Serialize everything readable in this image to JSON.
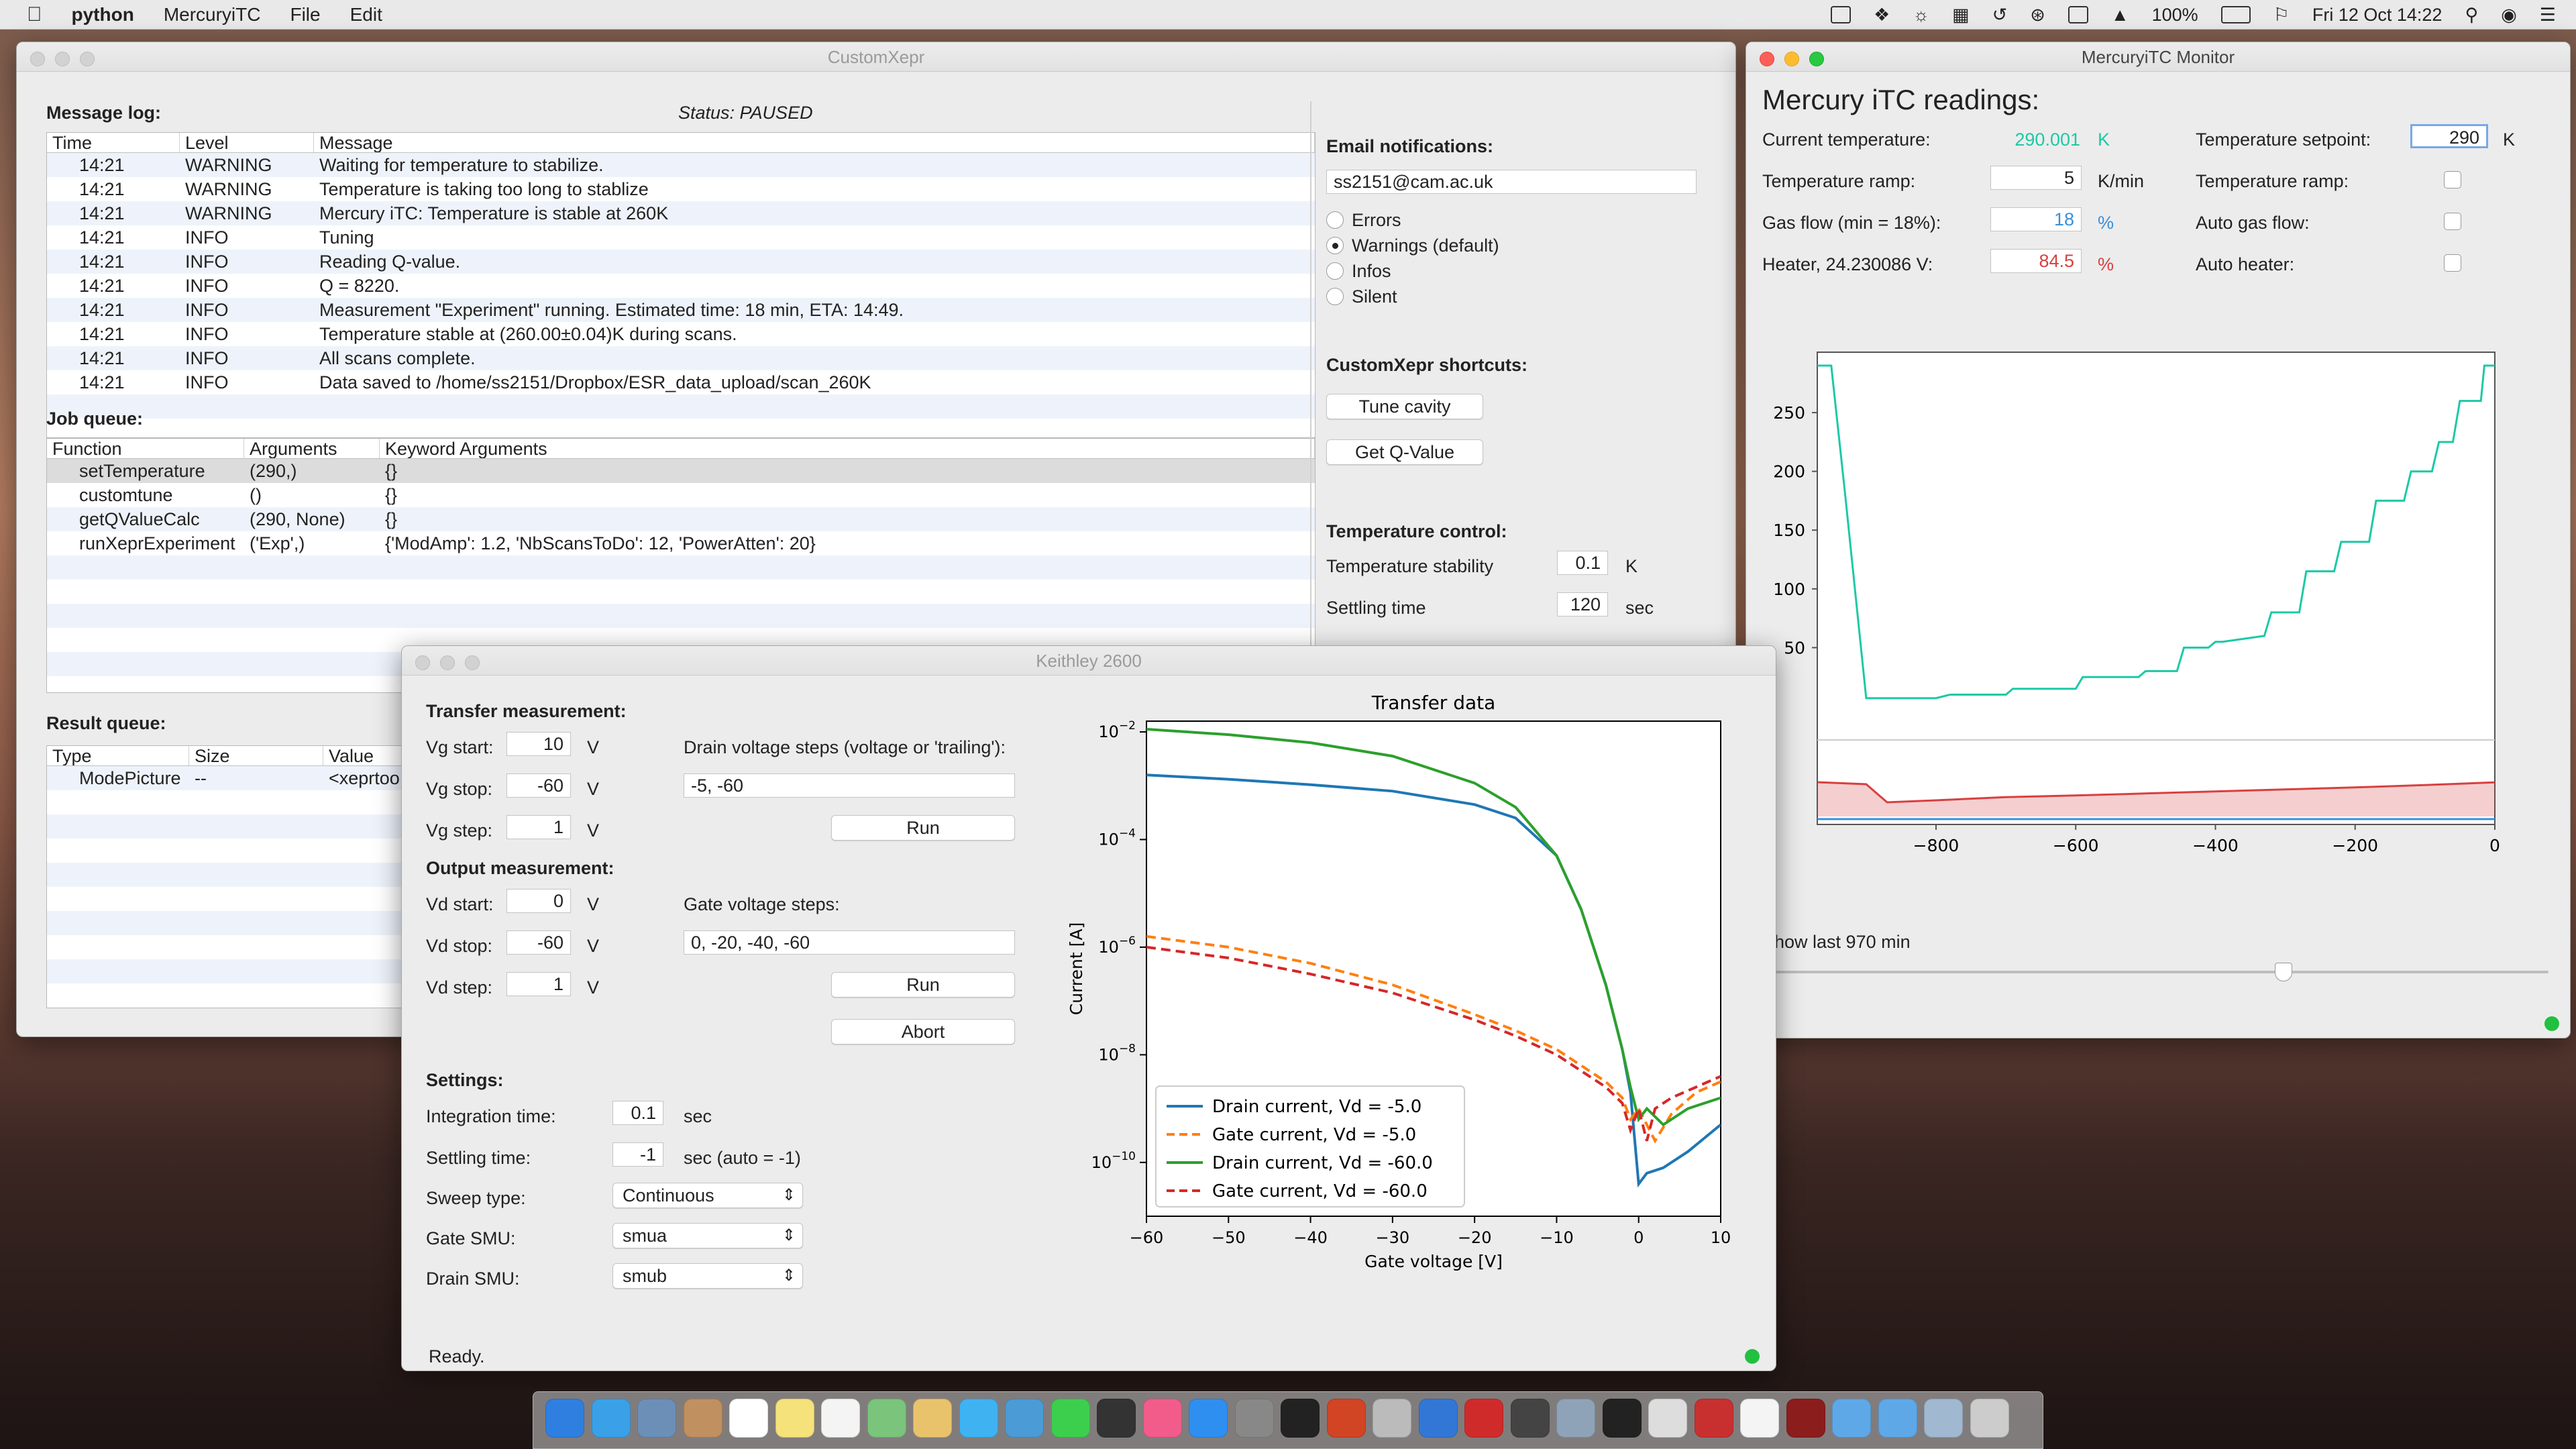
{
  "menubar": {
    "apple": "",
    "app": "python",
    "items": [
      "MercuryiTC",
      "File",
      "Edit"
    ],
    "battery": "100%",
    "datetime": "Fri 12 Oct  14:22"
  },
  "customxepr": {
    "title": "CustomXepr",
    "message_log_label": "Message log:",
    "status": "Status: PAUSED",
    "log_columns": [
      "Time",
      "Level",
      "Message"
    ],
    "log_rows": [
      [
        "14:21",
        "WARNING",
        "Waiting for temperature to stabilize."
      ],
      [
        "14:21",
        "WARNING",
        "Temperature is taking too long to stablize"
      ],
      [
        "14:21",
        "WARNING",
        "Mercury iTC: Temperature is stable at 260K"
      ],
      [
        "14:21",
        "INFO",
        "Tuning"
      ],
      [
        "14:21",
        "INFO",
        "Reading Q-value."
      ],
      [
        "14:21",
        "INFO",
        "Q = 8220."
      ],
      [
        "14:21",
        "INFO",
        "Measurement \"Experiment\" running. Estimated time: 18 min, ETA: 14:49."
      ],
      [
        "14:21",
        "INFO",
        "Temperature stable at (260.00±0.04)K during scans."
      ],
      [
        "14:21",
        "INFO",
        "All scans complete."
      ],
      [
        "14:21",
        "INFO",
        "Data saved to /home/ss2151/Dropbox/ESR_data_upload/scan_260K"
      ]
    ],
    "job_queue_label": "Job queue:",
    "job_columns": [
      "Function",
      "Arguments",
      "Keyword Arguments"
    ],
    "job_rows": [
      [
        "setTemperature",
        "(290,)",
        "{}"
      ],
      [
        "customtune",
        "()",
        "{}"
      ],
      [
        "getQValueCalc",
        "(290, None)",
        "{}"
      ],
      [
        "runXeprExperiment",
        "('Exp',)",
        "{'ModAmp': 1.2, 'NbScansToDo': 12, 'PowerAtten': 20}"
      ]
    ],
    "result_queue_label": "Result queue:",
    "result_columns": [
      "Type",
      "Size",
      "Value"
    ],
    "result_rows": [
      [
        "ModePicture",
        "--",
        "<xeprtoo"
      ]
    ],
    "email_label": "Email notifications:",
    "email_value": "ss2151@cam.ac.uk",
    "notify_options": [
      "Errors",
      "Warnings (default)",
      "Infos",
      "Silent"
    ],
    "notify_selected": "Warnings (default)",
    "shortcuts_label": "CustomXepr shortcuts:",
    "tune_button": "Tune cavity",
    "qvalue_button": "Get Q-Value",
    "temp_control_label": "Temperature control:",
    "stability_label": "Temperature stability",
    "stability_value": "0.1",
    "stability_unit": "K",
    "settling_label": "Settling time",
    "settling_value": "120",
    "settling_unit": "sec"
  },
  "keithley": {
    "title": "Keithley 2600",
    "transfer_label": "Transfer measurement:",
    "vg_start_label": "Vg start:",
    "vg_start": "10",
    "vg_stop_label": "Vg stop:",
    "vg_stop": "-60",
    "vg_step_label": "Vg step:",
    "vg_step": "1",
    "unit_v": "V",
    "drain_steps_label": "Drain voltage steps (voltage or 'trailing'):",
    "drain_steps": "-5, -60",
    "run_label": "Run",
    "output_label": "Output measurement:",
    "vd_start_label": "Vd start:",
    "vd_start": "0",
    "vd_stop_label": "Vd stop:",
    "vd_stop": "-60",
    "vd_step_label": "Vd step:",
    "vd_step": "1",
    "gate_steps_label": "Gate voltage steps:",
    "gate_steps": "0, -20, -40, -60",
    "abort_label": "Abort",
    "settings_label": "Settings:",
    "integration_label": "Integration time:",
    "integration": "0.1",
    "integration_unit": "sec",
    "settling_label": "Settling time:",
    "settling": "-1",
    "settling_unit": "sec (auto = -1)",
    "sweep_label": "Sweep type:",
    "sweep": "Continuous",
    "gate_smu_label": "Gate SMU:",
    "gate_smu": "smua",
    "drain_smu_label": "Drain SMU:",
    "drain_smu": "smub",
    "status": "Ready."
  },
  "mercury": {
    "title": "MercuryiTC Monitor",
    "heading": "Mercury iTC readings:",
    "current_temp_label": "Current temperature:",
    "current_temp": "290.001",
    "k": "K",
    "setpoint_label": "Temperature setpoint:",
    "setpoint": "290",
    "ramp_label": "Temperature ramp:",
    "ramp": "5",
    "ramp_unit": "K/min",
    "ramp_toggle_label": "Temperature ramp:",
    "gas_label": "Gas flow (min = 18%):",
    "gas": "18",
    "percent": "%",
    "auto_gas_label": "Auto gas flow:",
    "heater_label": "Heater, 24.230086 V:",
    "heater": "84.5",
    "auto_heater_label": "Auto heater:",
    "show_last": "Show last 970 min",
    "colors": {
      "temp": "#1cc9a5",
      "gas": "#3a8fd8",
      "heater": "#d84040"
    }
  },
  "chart_data": [
    {
      "type": "line",
      "title": "Transfer data",
      "xlabel": "Gate voltage [V]",
      "ylabel": "Current [A]",
      "yscale": "log",
      "xlim": [
        -60,
        10
      ],
      "ylim_log10": [
        -11,
        -1.8
      ],
      "x_ticks": [
        -60,
        -50,
        -40,
        -30,
        -20,
        -10,
        0,
        10
      ],
      "y_ticks": [
        "10^-2",
        "10^-4",
        "10^-6",
        "10^-8",
        "10^-10"
      ],
      "legend_position": "lower-left",
      "series": [
        {
          "name": "Drain current, Vd = -5.0",
          "color": "#1f77b4",
          "dash": false,
          "x": [
            -60,
            -50,
            -40,
            -30,
            -20,
            -15,
            -10,
            -7,
            -4,
            -2,
            -1,
            0,
            1,
            3,
            6,
            10
          ],
          "log10_y": [
            -2.8,
            -2.88,
            -2.98,
            -3.1,
            -3.35,
            -3.6,
            -4.3,
            -5.3,
            -6.7,
            -7.9,
            -8.7,
            -10.4,
            -10.2,
            -10.1,
            -9.8,
            -9.3
          ]
        },
        {
          "name": "Gate current, Vd = -5.0",
          "color": "#ff7f0e",
          "dash": true,
          "x": [
            -60,
            -50,
            -40,
            -30,
            -20,
            -15,
            -10,
            -7,
            -4,
            -2,
            -1,
            0,
            1,
            2,
            4,
            7,
            10
          ],
          "log10_y": [
            -5.8,
            -6.0,
            -6.3,
            -6.7,
            -7.25,
            -7.55,
            -7.9,
            -8.2,
            -8.5,
            -8.8,
            -9.2,
            -9.0,
            -9.3,
            -9.6,
            -9.1,
            -8.7,
            -8.5
          ]
        },
        {
          "name": "Drain current, Vd = -60.0",
          "color": "#2ca02c",
          "dash": false,
          "x": [
            -60,
            -50,
            -40,
            -30,
            -20,
            -15,
            -10,
            -7,
            -4,
            -2,
            -1,
            0,
            1,
            3,
            6,
            10
          ],
          "log10_y": [
            -1.95,
            -2.05,
            -2.2,
            -2.45,
            -2.95,
            -3.4,
            -4.3,
            -5.3,
            -6.7,
            -7.9,
            -8.6,
            -9.2,
            -9.0,
            -9.3,
            -9.0,
            -8.8
          ]
        },
        {
          "name": "Gate current, Vd = -60.0",
          "color": "#d62728",
          "dash": true,
          "x": [
            -60,
            -50,
            -40,
            -30,
            -20,
            -15,
            -10,
            -7,
            -4,
            -2,
            -1,
            0,
            1,
            2,
            4,
            7,
            10
          ],
          "log10_y": [
            -6.0,
            -6.2,
            -6.5,
            -6.85,
            -7.35,
            -7.65,
            -8.0,
            -8.3,
            -8.6,
            -8.9,
            -9.4,
            -9.0,
            -9.6,
            -9.0,
            -8.8,
            -8.6,
            -8.4
          ]
        }
      ]
    },
    {
      "type": "line",
      "title": "",
      "xlabel": "",
      "ylabel": "",
      "xlim": [
        -970,
        0
      ],
      "ylim": [
        0,
        290
      ],
      "x_ticks": [
        -800,
        -600,
        -400,
        -200,
        0
      ],
      "y_ticks": [
        50,
        100,
        150,
        200,
        250
      ],
      "series": [
        {
          "name": "",
          "color": "#1cc9a5",
          "x": [
            -970,
            -950,
            -930,
            -900,
            -870,
            -800,
            -780,
            -700,
            -690,
            -600,
            -590,
            -510,
            -500,
            -455,
            -445,
            -410,
            -400,
            -390,
            -330,
            -320,
            -280,
            -270,
            -230,
            -220,
            -180,
            -170,
            -130,
            -120,
            -90,
            -80,
            -60,
            -50,
            -20,
            -15,
            0
          ],
          "y": [
            290,
            290,
            180,
            7,
            7,
            7,
            10,
            10,
            15,
            15,
            25,
            25,
            30,
            30,
            50,
            50,
            55,
            55,
            60,
            80,
            80,
            115,
            115,
            140,
            140,
            175,
            175,
            200,
            200,
            225,
            225,
            260,
            260,
            290,
            290
          ]
        },
        {
          "name": "",
          "color": "#d84040",
          "fill": true,
          "x": [
            -970,
            -900,
            -870,
            -800,
            -700,
            -600,
            -500,
            -400,
            -300,
            -200,
            -100,
            0
          ],
          "y": [
            85,
            80,
            35,
            40,
            48,
            52,
            57,
            62,
            67,
            72,
            78,
            84.5
          ]
        }
      ]
    }
  ],
  "dock": {
    "icons": [
      "finder-icon",
      "safari-icon",
      "preview-icon",
      "contacts-icon",
      "calendar-icon",
      "notes-icon",
      "reminders-icon",
      "maps-icon",
      "photos-icon",
      "messages-icon",
      "tweetbot-icon",
      "facetime-icon",
      "stocks-icon",
      "itunes-icon",
      "appstore-icon",
      "preferences-icon",
      "activity-icon",
      "powerpoint-icon",
      "spider-icon",
      "xcode-icon",
      "zotero-icon",
      "github-icon",
      "folder-icon",
      "terminal-icon",
      "script-icon",
      "xepr-icon",
      "doc-icon",
      "pdf-icon",
      "folder-icon",
      "folder-icon",
      "download-icon",
      "trash-icon"
    ]
  }
}
